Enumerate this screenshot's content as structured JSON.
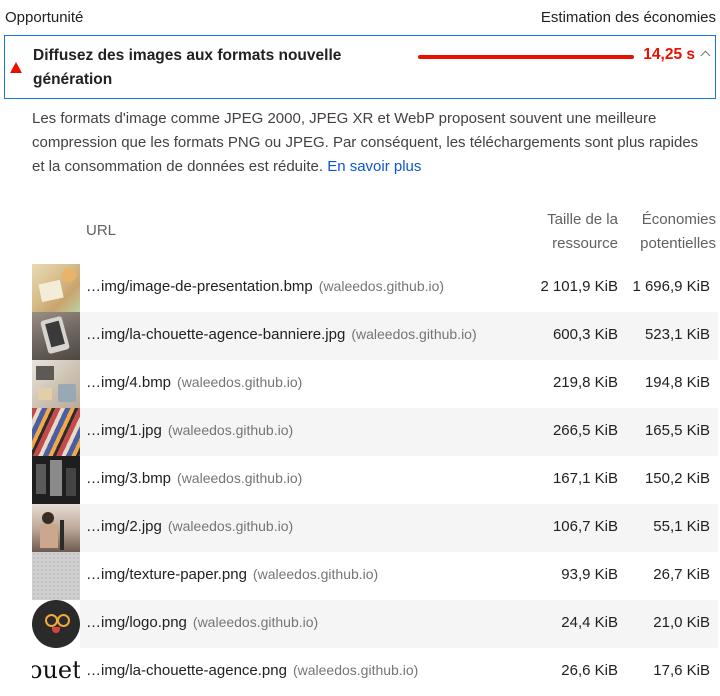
{
  "header": {
    "left": "Opportunité",
    "right": "Estimation des économies"
  },
  "audit": {
    "title": "Diffusez des images aux formats nouvelle génération",
    "savings": "14,25 s",
    "status_color": "#eb0f00",
    "description": "Les formats d'image comme JPEG 2000, JPEG XR et WebP proposent souvent une meilleure compression que les formats PNG ou JPEG. Par conséquent, les téléchargements sont plus rapides et la consommation de données est réduite.",
    "learn_more": "En savoir plus"
  },
  "table": {
    "columns": {
      "url": "URL",
      "size": "Taille de la ressource",
      "savings": "Économies potentielles"
    },
    "rows": [
      {
        "thumb": "1",
        "url": "…img/image-de-presentation.bmp",
        "host": "(waleedos.github.io)",
        "size": "2 101,9 KiB",
        "savings": "1 696,9 KiB"
      },
      {
        "thumb": "2",
        "url": "…img/la-chouette-agence-banniere.jpg",
        "host": "(waleedos.github.io)",
        "size": "600,3 KiB",
        "savings": "523,1 KiB"
      },
      {
        "thumb": "3",
        "url": "…img/4.bmp",
        "host": "(waleedos.github.io)",
        "size": "219,8 KiB",
        "savings": "194,8 KiB"
      },
      {
        "thumb": "4",
        "url": "…img/1.jpg",
        "host": "(waleedos.github.io)",
        "size": "266,5 KiB",
        "savings": "165,5 KiB"
      },
      {
        "thumb": "5",
        "url": "…img/3.bmp",
        "host": "(waleedos.github.io)",
        "size": "167,1 KiB",
        "savings": "150,2 KiB"
      },
      {
        "thumb": "6",
        "url": "…img/2.jpg",
        "host": "(waleedos.github.io)",
        "size": "106,7 KiB",
        "savings": "55,1 KiB"
      },
      {
        "thumb": "7",
        "url": "…img/texture-paper.png",
        "host": "(waleedos.github.io)",
        "size": "93,9 KiB",
        "savings": "26,7 KiB"
      },
      {
        "thumb": "8",
        "url": "…img/logo.png",
        "host": "(waleedos.github.io)",
        "size": "24,4 KiB",
        "savings": "21,0 KiB"
      },
      {
        "thumb": "9",
        "url": "…img/la-chouette-agence.png",
        "host": "(waleedos.github.io)",
        "size": "26,6 KiB",
        "savings": "17,6 KiB"
      }
    ]
  },
  "thumb9_text": "ouette"
}
